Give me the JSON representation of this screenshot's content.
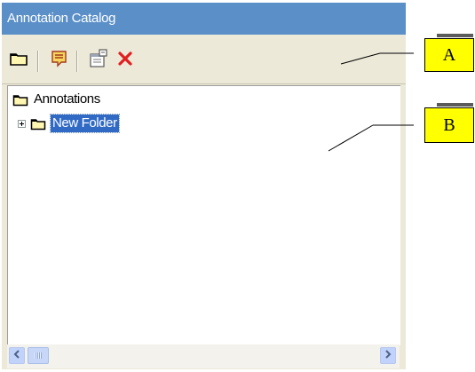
{
  "panel": {
    "title": "Annotation Catalog"
  },
  "toolbar": {
    "buttons": [
      {
        "icon": "folder-icon"
      },
      {
        "icon": "note-icon"
      },
      {
        "icon": "properties-icon"
      },
      {
        "icon": "delete-icon"
      }
    ]
  },
  "tree": {
    "root": {
      "label": "Annotations",
      "icon": "folder-icon"
    },
    "children": [
      {
        "label": "New Folder",
        "icon": "folder-icon",
        "expander": "plus",
        "selected": true
      }
    ]
  },
  "callouts": [
    {
      "label": "A"
    },
    {
      "label": "B"
    }
  ],
  "colors": {
    "titlebar": "#5a8fc8",
    "selection": "#316ac5",
    "callout": "#ffff00",
    "delete": "#e02020"
  }
}
